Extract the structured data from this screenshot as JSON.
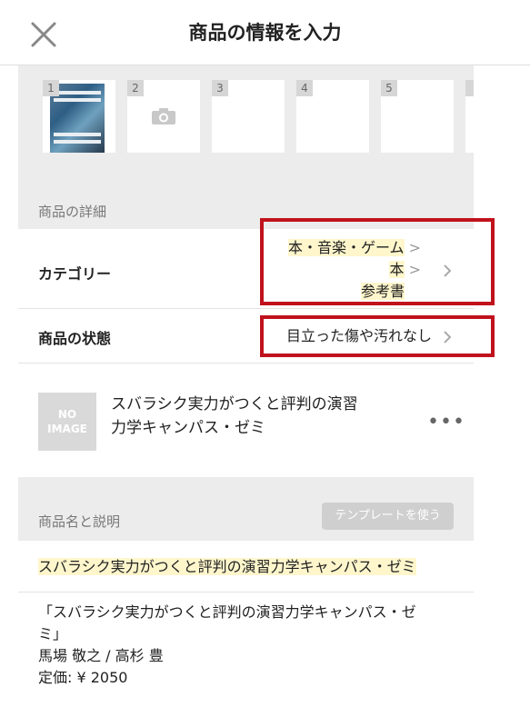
{
  "header": {
    "title": "商品の情報を入力"
  },
  "photos": [
    {
      "num": "1"
    },
    {
      "num": "2"
    },
    {
      "num": "3"
    },
    {
      "num": "4"
    },
    {
      "num": "5"
    }
  ],
  "details": {
    "section_label": "商品の詳細",
    "category": {
      "label": "カテゴリー",
      "levels": [
        "本・音楽・ゲーム",
        "本",
        "参考書"
      ]
    },
    "condition": {
      "label": "商品の状態",
      "value": "目立った傷や汚れなし"
    }
  },
  "product_card": {
    "no_image_line1": "NO",
    "no_image_line2": "IMAGE",
    "title_line1": "スバラシク実力がつくと評判の演習",
    "title_line2": "力学キャンパス・ゼミ"
  },
  "description": {
    "section_label": "商品名と説明",
    "template_button": "テンプレートを使う",
    "name": "スバラシク実力がつくと評判の演習力学キャンパス・ゼミ",
    "body_line1": "「スバラシク実力がつくと評判の演習力学キャンパス・ゼ",
    "body_line2": "ミ」",
    "body_line3": "馬場 敬之 / 高杉 豊",
    "body_line4": "定価: ¥ 2050"
  },
  "colors": {
    "highlight_box": "#c0121c",
    "text_highlight": "#fff6cc",
    "section_bg": "#ececec"
  }
}
